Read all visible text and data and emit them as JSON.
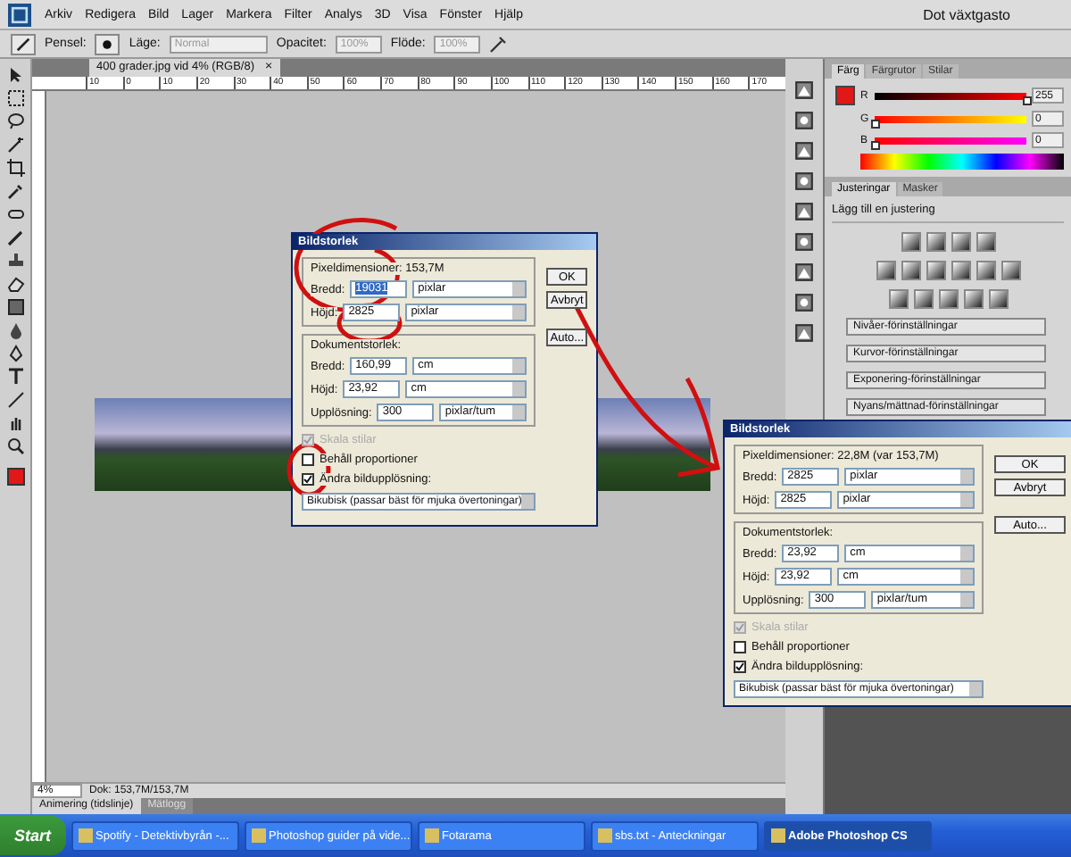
{
  "menubar": {
    "menus": [
      "Arkiv",
      "Redigera",
      "Bild",
      "Lager",
      "Markera",
      "Filter",
      "Analys",
      "3D",
      "Visa",
      "Fönster",
      "Hjälp"
    ],
    "workspace": "Dot växtgasto"
  },
  "options": {
    "brush_label": "Pensel:",
    "mode_label": "Läge:",
    "mode": "Normal",
    "opacity_label": "Opacitet:",
    "opacity": "100%",
    "flow_label": "Flöde:",
    "flow": "100%"
  },
  "document": {
    "tab": "400 grader.jpg vid 4% (RGB/8)",
    "close": "×",
    "ruler": [
      "10",
      "0",
      "10",
      "20",
      "30",
      "40",
      "50",
      "60",
      "70",
      "80",
      "90",
      "100",
      "110",
      "120",
      "130",
      "140",
      "150",
      "160",
      "170"
    ]
  },
  "status": {
    "zoom": "4%",
    "doc": "Dok: 153,7M/153,7M"
  },
  "bottom_tabs": [
    {
      "label": "Animering (tidslinje)",
      "selected": true
    },
    {
      "label": "Mätlogg",
      "selected": false
    }
  ],
  "dialogs": [
    {
      "title": "Bildstorlek",
      "pixel_header": "Pixeldimensioner: 153,7M",
      "pixel_fields": [
        {
          "label": "Bredd:",
          "value": "19031",
          "unit": "pixlar",
          "highlighted": true
        },
        {
          "label": "Höjd:",
          "value": "2825",
          "unit": "pixlar",
          "highlighted": false
        }
      ],
      "doc_header": "Dokumentstorlek:",
      "doc_fields": [
        {
          "label": "Bredd:",
          "value": "160,99",
          "unit": "cm"
        },
        {
          "label": "Höjd:",
          "value": "23,92",
          "unit": "cm"
        },
        {
          "label": "Upplösning:",
          "value": "300",
          "unit": "pixlar/tum"
        }
      ],
      "checkboxes": [
        {
          "label": "Skala stilar",
          "checked": true,
          "disabled": true
        },
        {
          "label": "Behåll proportioner",
          "checked": false,
          "disabled": false
        },
        {
          "label": "Ändra bildupplösning:",
          "checked": true,
          "disabled": false
        }
      ],
      "resample": "Bikubisk (passar bäst för mjuka övertoningar)",
      "buttons": [
        "OK",
        "Avbryt",
        "Auto..."
      ]
    },
    {
      "title": "Bildstorlek",
      "pixel_header": "Pixeldimensioner: 22,8M (var 153,7M)",
      "pixel_fields": [
        {
          "label": "Bredd:",
          "value": "2825",
          "unit": "pixlar",
          "highlighted": false
        },
        {
          "label": "Höjd:",
          "value": "2825",
          "unit": "pixlar",
          "highlighted": false
        }
      ],
      "doc_header": "Dokumentstorlek:",
      "doc_fields": [
        {
          "label": "Bredd:",
          "value": "23,92",
          "unit": "cm"
        },
        {
          "label": "Höjd:",
          "value": "23,92",
          "unit": "cm"
        },
        {
          "label": "Upplösning:",
          "value": "300",
          "unit": "pixlar/tum"
        }
      ],
      "checkboxes": [
        {
          "label": "Skala stilar",
          "checked": true,
          "disabled": true
        },
        {
          "label": "Behåll proportioner",
          "checked": false,
          "disabled": false
        },
        {
          "label": "Ändra bildupplösning:",
          "checked": true,
          "disabled": false
        }
      ],
      "resample": "Bikubisk (passar bäst för mjuka övertoningar)",
      "buttons": [
        "OK",
        "Avbryt",
        "Auto..."
      ]
    }
  ],
  "color_panel": {
    "tabs": [
      {
        "label": "Färg",
        "selected": true
      },
      {
        "label": "Färgrutor",
        "selected": false
      },
      {
        "label": "Stilar",
        "selected": false
      }
    ],
    "channels": [
      {
        "name": "R",
        "level": 1,
        "reading": "255"
      },
      {
        "name": "G",
        "level": 0,
        "reading": "0"
      },
      {
        "name": "B",
        "level": 0,
        "reading": "0"
      }
    ]
  },
  "adjust_panel": {
    "tabs": [
      {
        "label": "Justeringar",
        "selected": true
      },
      {
        "label": "Masker",
        "selected": false
      }
    ],
    "title": "Lägg till en justering",
    "presets": [
      "Nivåer-förinställningar",
      "Kurvor-förinställningar",
      "Exponering-förinställningar",
      "Nyans/mättnad-förinställningar"
    ]
  },
  "taskbar": {
    "start": "Start",
    "items": [
      {
        "label": "Spotify - Detektivbyrån -...",
        "selected": false
      },
      {
        "label": "Photoshop guider på vide...",
        "selected": false
      },
      {
        "label": "Fotarama",
        "selected": false
      },
      {
        "label": "sbs.txt - Anteckningar",
        "selected": false
      },
      {
        "label": "Adobe Photoshop CS",
        "selected": true
      }
    ]
  }
}
